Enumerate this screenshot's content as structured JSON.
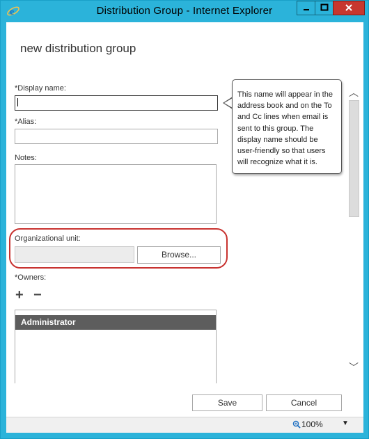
{
  "window": {
    "title": "Distribution Group - Internet Explorer",
    "controls": {
      "minimize": "▁",
      "maximize": "□",
      "close": "✕"
    }
  },
  "form": {
    "title": "new distribution group",
    "display_name_label": "*Display name:",
    "display_name_value": "",
    "alias_label": "*Alias:",
    "alias_value": "",
    "notes_label": "Notes:",
    "notes_value": "",
    "ou_label": "Organizational unit:",
    "ou_value": "",
    "browse_label": "Browse...",
    "owners_label": "*Owners:",
    "add_glyph": "+",
    "remove_glyph": "−",
    "owners": [
      "Administrator"
    ],
    "save_label": "Save",
    "cancel_label": "Cancel"
  },
  "tooltip": {
    "text": "This name will appear in the address book and on the To and Cc lines when email is sent to this group. The display name should be user-friendly so that users will recognize what it is."
  },
  "scrollbar": {
    "up": "︿",
    "down": "﹀"
  },
  "status": {
    "zoom": "100%",
    "zoom_dropdown": "▼"
  },
  "colors": {
    "titlebar": "#2bb3da",
    "close": "#c7372e",
    "highlight": "#c8322f",
    "selected_row": "#5d5d5d"
  },
  "icons": [
    "ie-icon",
    "add-icon",
    "remove-icon",
    "zoom-icon",
    "chevron-up-icon",
    "chevron-down-icon"
  ]
}
